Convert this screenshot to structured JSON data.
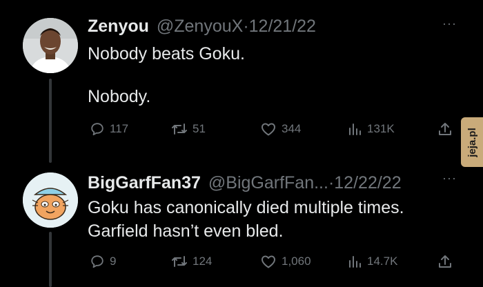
{
  "tweets": [
    {
      "name": "Zenyou",
      "handle": "@ZenyouX",
      "separator": "·",
      "date": "12/21/22",
      "more": "···",
      "lines": [
        "Nobody beats Goku.",
        "Nobody."
      ],
      "stats": {
        "replies": "117",
        "retweets": "51",
        "likes": "344",
        "views": "131K"
      }
    },
    {
      "name": "BigGarfFan37",
      "handle": "@BigGarfFan...",
      "separator": "·",
      "date": "12/22/22",
      "more": "···",
      "lines": [
        "Goku has canonically died multiple times.",
        "Garfield hasn’t even bled."
      ],
      "stats": {
        "replies": "9",
        "retweets": "124",
        "likes": "1,060",
        "views": "14.7K"
      }
    }
  ],
  "watermark": "jeja.pl",
  "colors": {
    "background": "#000000",
    "text": "#e7e9ea",
    "muted": "#71767b",
    "thread": "#333639",
    "watermark_bg": "#c9ab7a"
  },
  "icons": [
    "reply-icon",
    "retweet-icon",
    "like-icon",
    "views-icon",
    "share-icon",
    "more-icon"
  ]
}
